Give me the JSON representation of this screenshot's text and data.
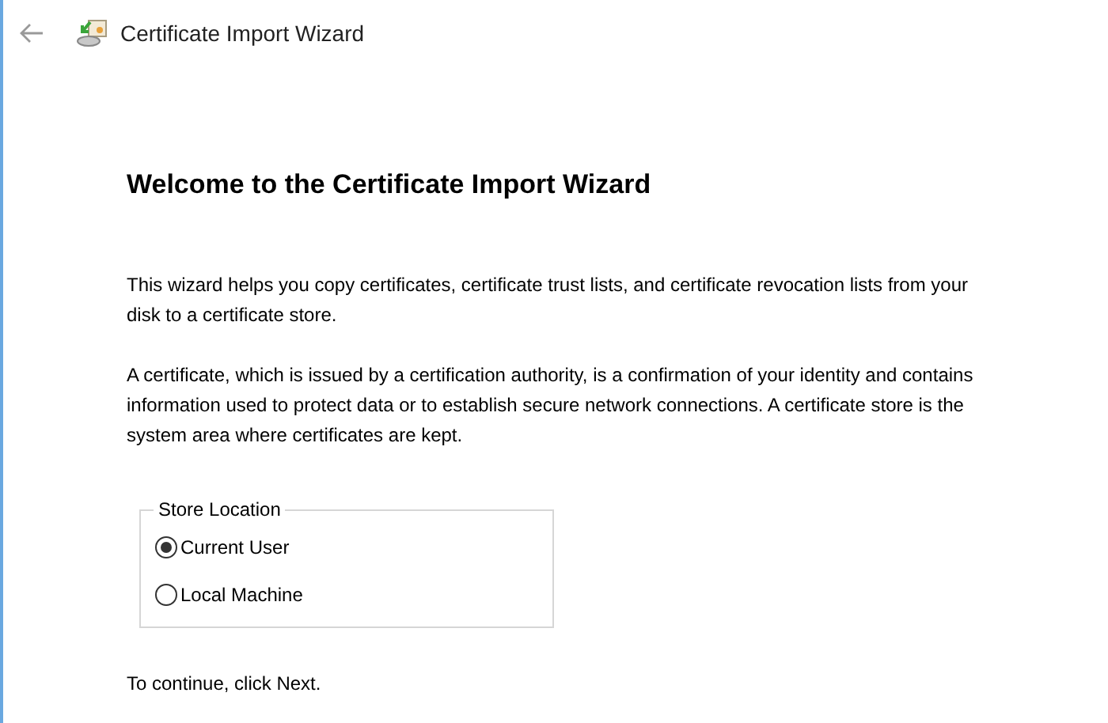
{
  "window": {
    "title": "Certificate Import Wizard"
  },
  "heading": "Welcome to the Certificate Import Wizard",
  "paragraphs": [
    "This wizard helps you copy certificates, certificate trust lists, and certificate revocation lists from your disk to a certificate store.",
    "A certificate, which is issued by a certification authority, is a confirmation of your identity and contains information used to protect data or to establish secure network connections. A certificate store is the system area where certificates are kept."
  ],
  "store_location": {
    "label": "Store Location",
    "options": [
      {
        "label": "Current User",
        "selected": true
      },
      {
        "label": "Local Machine",
        "selected": false
      }
    ]
  },
  "footer": "To continue, click Next."
}
